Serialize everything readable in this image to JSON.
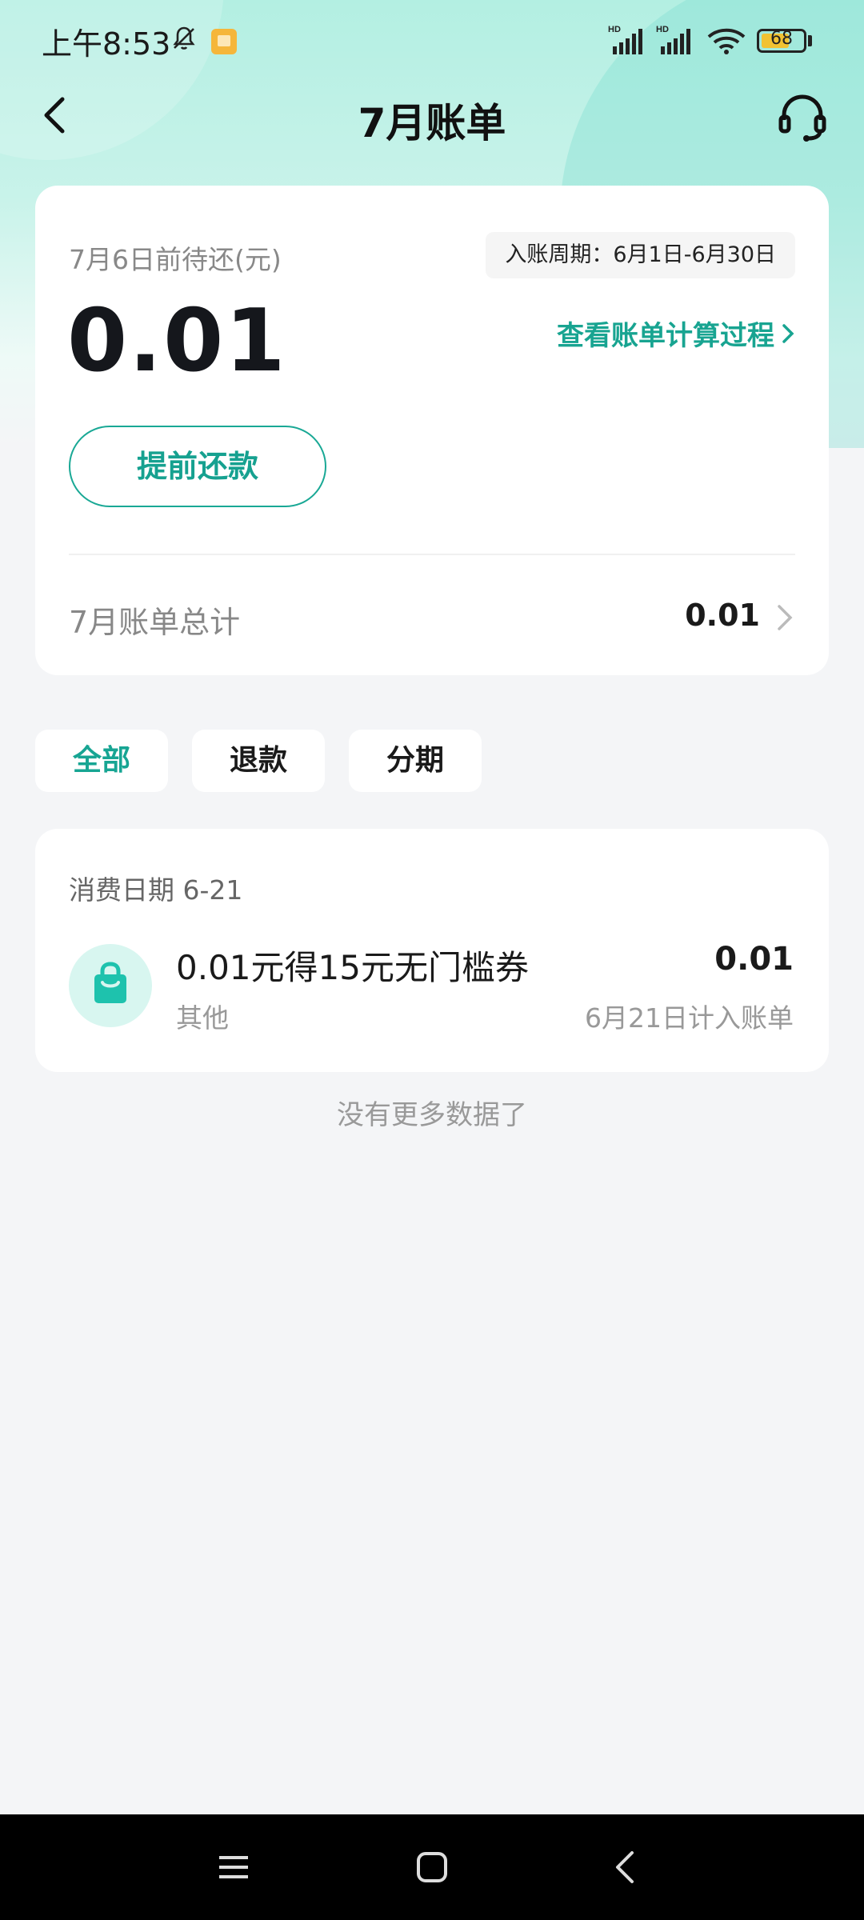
{
  "status_bar": {
    "time": "上午8:53",
    "battery": "68",
    "battery_level": 0.68,
    "signal1_label": "HD",
    "signal2_label": "HD"
  },
  "nav": {
    "title": "7月账单"
  },
  "bill": {
    "due_label": "7月6日前待还(元)",
    "period": "入账周期：6月1日-6月30日",
    "amount": "0.01",
    "calc_link": "查看账单计算过程",
    "prepay_button": "提前还款",
    "total_label": "7月账单总计",
    "total_value": "0.01"
  },
  "tabs": [
    {
      "label": "全部",
      "active": true
    },
    {
      "label": "退款",
      "active": false
    },
    {
      "label": "分期",
      "active": false
    }
  ],
  "transactions": [
    {
      "date_label": "消费日期 6-21",
      "title": "0.01元得15元无门槛券",
      "category": "其他",
      "amount": "0.01",
      "posted": "6月21日计入账单"
    }
  ],
  "no_more": "没有更多数据了",
  "colors": {
    "accent": "#18a491",
    "icon_bg": "#d8f6f0",
    "hero_top": "#b3efe2",
    "page_bg": "#f4f5f7"
  },
  "icons": {
    "back": "chevron-left-icon",
    "service": "headset-icon",
    "tx": "shopping-bag-icon"
  }
}
